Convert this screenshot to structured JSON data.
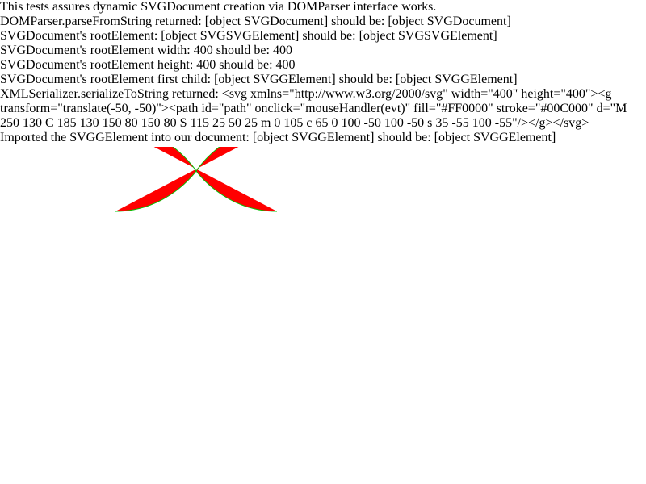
{
  "log": {
    "lines": [
      "This tests assures dynamic SVGDocument creation via DOMParser interface works.",
      "DOMParser.parseFromString returned: [object SVGDocument] should be: [object SVGDocument]",
      "SVGDocument's rootElement: [object SVGSVGElement] should be: [object SVGSVGElement]",
      "SVGDocument's rootElement width: 400 should be: 400",
      "SVGDocument's rootElement height: 400 should be: 400",
      "SVGDocument's rootElement first child: [object SVGGElement] should be: [object SVGGElement]",
      "XMLSerializer.serializeToString returned: <svg xmlns=\"http://www.w3.org/2000/svg\" width=\"400\" height=\"400\"><g transform=\"translate(-50, -50)\"><path id=\"path\" onclick=\"mouseHandler(evt)\" fill=\"#FF0000\" stroke=\"#00C000\" d=\"M 250 130 C 185 130 150 80 150 80 S 115 25 50 25 m 0 105 c 65 0 100 -50 100 -50 s 35 -55 100 -55\"/></g></svg>",
      "Imported the SVGGElement into our document: [object SVGGElement] should be: [object SVGGElement]"
    ]
  },
  "shape": {
    "fill": "#FF0000",
    "stroke": "#00C000"
  }
}
